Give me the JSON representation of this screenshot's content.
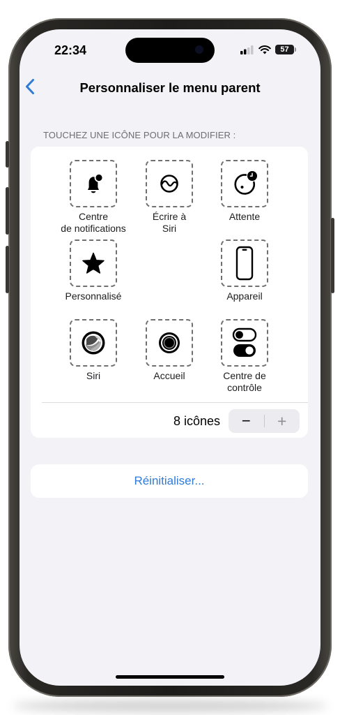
{
  "status": {
    "time": "22:34",
    "battery": "57"
  },
  "nav": {
    "title": "Personnaliser le menu parent"
  },
  "section": {
    "header": "TOUCHEZ UNE ICÔNE POUR LA MODIFIER :"
  },
  "slots": [
    {
      "icon": "bell-badge-icon",
      "label": "Centre\nde notifications"
    },
    {
      "icon": "scribble-icon",
      "label": "Écrire à\nSiri"
    },
    {
      "icon": "clock-dial-icon",
      "label": "Attente"
    },
    {
      "icon": "star-icon",
      "label": "Personnalisé"
    },
    {
      "icon": "device-icon",
      "label": "Appareil"
    },
    {
      "icon": "siri-orb-icon",
      "label": "Siri"
    },
    {
      "icon": "home-button-icon",
      "label": "Accueil"
    },
    {
      "icon": "toggles-icon",
      "label": "Centre de\ncontrôle"
    }
  ],
  "counter": {
    "label": "8 icônes",
    "minus": "−",
    "plus": "+"
  },
  "reset": {
    "label": "Réinitialiser..."
  },
  "colors": {
    "accent": "#2f7bd6",
    "background": "#f2f2f7"
  }
}
